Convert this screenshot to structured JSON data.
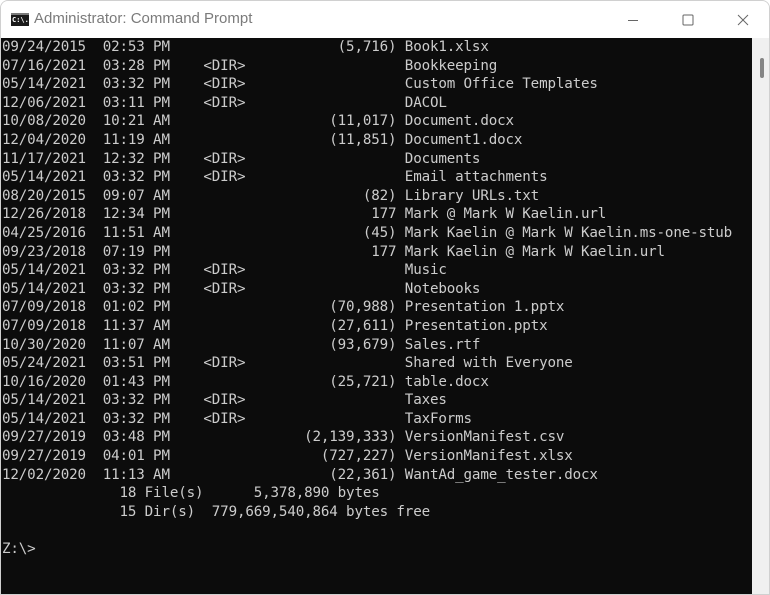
{
  "window": {
    "title": "Administrator: Command Prompt",
    "app_icon_label": "C:\\.",
    "controls": {
      "minimize": "minimize-icon",
      "maximize": "maximize-icon",
      "close": "close-icon"
    }
  },
  "listing": [
    {
      "date": "09/24/2015",
      "time": "02:53 PM",
      "type": "",
      "size": "(5,716)",
      "name": "Book1.xlsx"
    },
    {
      "date": "07/16/2021",
      "time": "03:28 PM",
      "type": "<DIR>",
      "size": "",
      "name": "Bookkeeping"
    },
    {
      "date": "05/14/2021",
      "time": "03:32 PM",
      "type": "<DIR>",
      "size": "",
      "name": "Custom Office Templates"
    },
    {
      "date": "12/06/2021",
      "time": "03:11 PM",
      "type": "<DIR>",
      "size": "",
      "name": "DACOL"
    },
    {
      "date": "10/08/2020",
      "time": "10:21 AM",
      "type": "",
      "size": "(11,017)",
      "name": "Document.docx"
    },
    {
      "date": "12/04/2020",
      "time": "11:19 AM",
      "type": "",
      "size": "(11,851)",
      "name": "Document1.docx"
    },
    {
      "date": "11/17/2021",
      "time": "12:32 PM",
      "type": "<DIR>",
      "size": "",
      "name": "Documents"
    },
    {
      "date": "05/14/2021",
      "time": "03:32 PM",
      "type": "<DIR>",
      "size": "",
      "name": "Email attachments"
    },
    {
      "date": "08/20/2015",
      "time": "09:07 AM",
      "type": "",
      "size": "(82)",
      "name": "Library URLs.txt"
    },
    {
      "date": "12/26/2018",
      "time": "12:34 PM",
      "type": "",
      "size": "177",
      "name": "Mark @ Mark W Kaelin.url"
    },
    {
      "date": "04/25/2016",
      "time": "11:51 AM",
      "type": "",
      "size": "(45)",
      "name": "Mark Kaelin @ Mark W Kaelin.ms-one-stub"
    },
    {
      "date": "09/23/2018",
      "time": "07:19 PM",
      "type": "",
      "size": "177",
      "name": "Mark Kaelin @ Mark W Kaelin.url"
    },
    {
      "date": "05/14/2021",
      "time": "03:32 PM",
      "type": "<DIR>",
      "size": "",
      "name": "Music"
    },
    {
      "date": "05/14/2021",
      "time": "03:32 PM",
      "type": "<DIR>",
      "size": "",
      "name": "Notebooks"
    },
    {
      "date": "07/09/2018",
      "time": "01:02 PM",
      "type": "",
      "size": "(70,988)",
      "name": "Presentation 1.pptx"
    },
    {
      "date": "07/09/2018",
      "time": "11:37 AM",
      "type": "",
      "size": "(27,611)",
      "name": "Presentation.pptx"
    },
    {
      "date": "10/30/2020",
      "time": "11:07 AM",
      "type": "",
      "size": "(93,679)",
      "name": "Sales.rtf"
    },
    {
      "date": "05/24/2021",
      "time": "03:51 PM",
      "type": "<DIR>",
      "size": "",
      "name": "Shared with Everyone"
    },
    {
      "date": "10/16/2020",
      "time": "01:43 PM",
      "type": "",
      "size": "(25,721)",
      "name": "table.docx"
    },
    {
      "date": "05/14/2021",
      "time": "03:32 PM",
      "type": "<DIR>",
      "size": "",
      "name": "Taxes"
    },
    {
      "date": "05/14/2021",
      "time": "03:32 PM",
      "type": "<DIR>",
      "size": "",
      "name": "TaxForms"
    },
    {
      "date": "09/27/2019",
      "time": "03:48 PM",
      "type": "",
      "size": "(2,139,333)",
      "name": "VersionManifest.csv"
    },
    {
      "date": "09/27/2019",
      "time": "04:01 PM",
      "type": "",
      "size": "(727,227)",
      "name": "VersionManifest.xlsx"
    },
    {
      "date": "12/02/2020",
      "time": "11:13 AM",
      "type": "",
      "size": "(22,361)",
      "name": "WantAd_game_tester.docx"
    }
  ],
  "summary": {
    "files_count": "18",
    "files_label": "File(s)",
    "files_bytes": "5,378,890",
    "files_bytes_label": "bytes",
    "dirs_count": "15",
    "dirs_label": "Dir(s)",
    "free_bytes": "779,669,540,864",
    "free_label": "bytes free"
  },
  "prompt": "Z:\\>",
  "colors": {
    "console_bg": "#0c0c0c",
    "console_fg": "#cccccc",
    "title_fg": "#7b7b7b"
  }
}
